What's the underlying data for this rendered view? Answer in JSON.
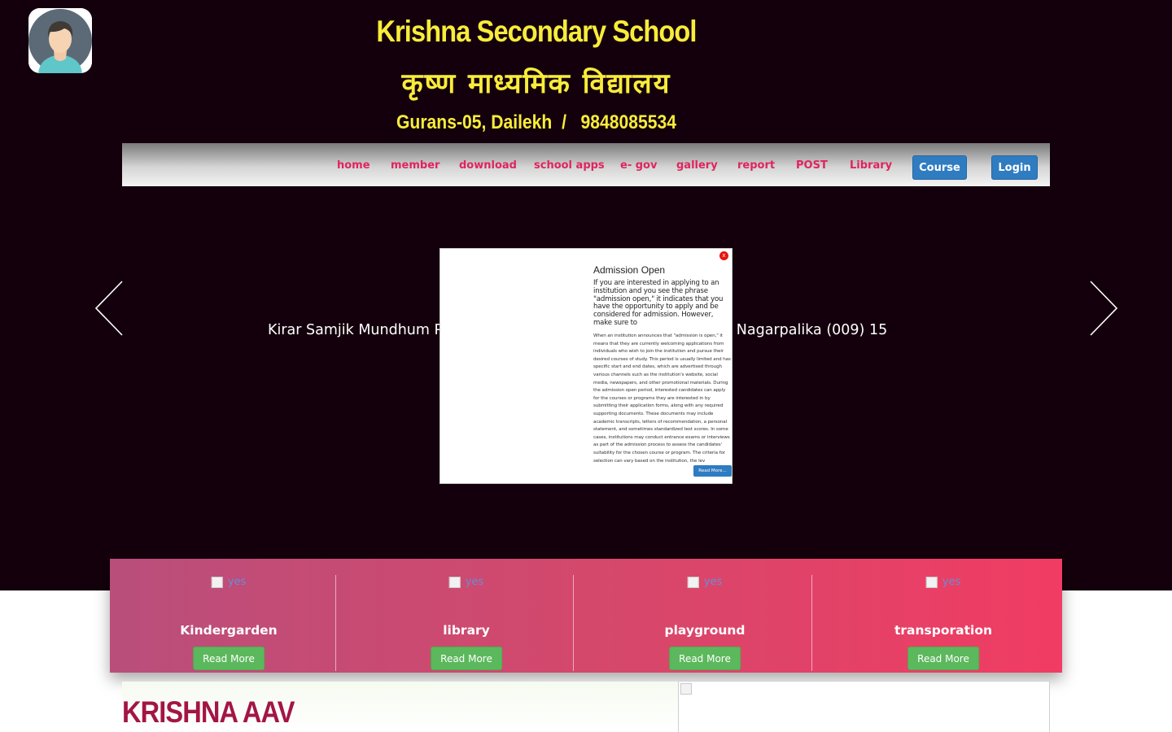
{
  "header": {
    "school_name": "Krishna Secondary School",
    "school_name_np": "कृष्ण माध्यमिक विद्यालय",
    "address": "Gurans-05, Dailekh  /   9848085534",
    "avatar_icon": "user-avatar-icon"
  },
  "nav": {
    "items": [
      "home",
      "member",
      "download",
      "school apps",
      "e- gov",
      "gallery",
      "report",
      "POST",
      "Library"
    ],
    "course_label": "Course",
    "login_label": "Login"
  },
  "carousel": {
    "caption": "Kirar Samjik Mundhum P                                                          ada Nagarpalika (009) 15",
    "prev_icon": "chevron-left-icon",
    "next_icon": "chevron-right-icon"
  },
  "popup": {
    "close_label": "x",
    "title": "Admission Open",
    "lead": "If you are interested in applying to an institution and you see the phrase \"admission open,\" it indicates that you have the opportunity to apply and be considered for admission. However, make sure to",
    "body": "When an institution announces that \"admission is open,\" it means that they are currently welcoming applications from individuals who wish to join the institution and pursue their desired courses of study. This period is usually limited and has specific start and end dates, which are advertised through various channels such as the institution's website, social media, newspapers, and other promotional materials. During the admission open period, interested candidates can apply for the courses or programs they are interested in by submitting their application forms, along with any required supporting documents. These documents may include academic transcripts, letters of recommendation, a personal statement, and sometimes standardized test scores. In some cases, institutions may conduct entrance exams or interviews as part of the admission process to assess the candidates' suitability for the chosen course or program. The criteria for selection can vary based on the institution, the lev",
    "read_more_label": "Read More..."
  },
  "services": [
    {
      "alt": "yes",
      "title": "Kindergarden",
      "button": "Read More"
    },
    {
      "alt": "yes",
      "title": "library",
      "button": "Read More"
    },
    {
      "alt": "yes",
      "title": "playground",
      "button": "Read More"
    },
    {
      "alt": "yes",
      "title": "transporation",
      "button": "Read More"
    }
  ],
  "about": {
    "title": "KRISHNA AAV"
  }
}
